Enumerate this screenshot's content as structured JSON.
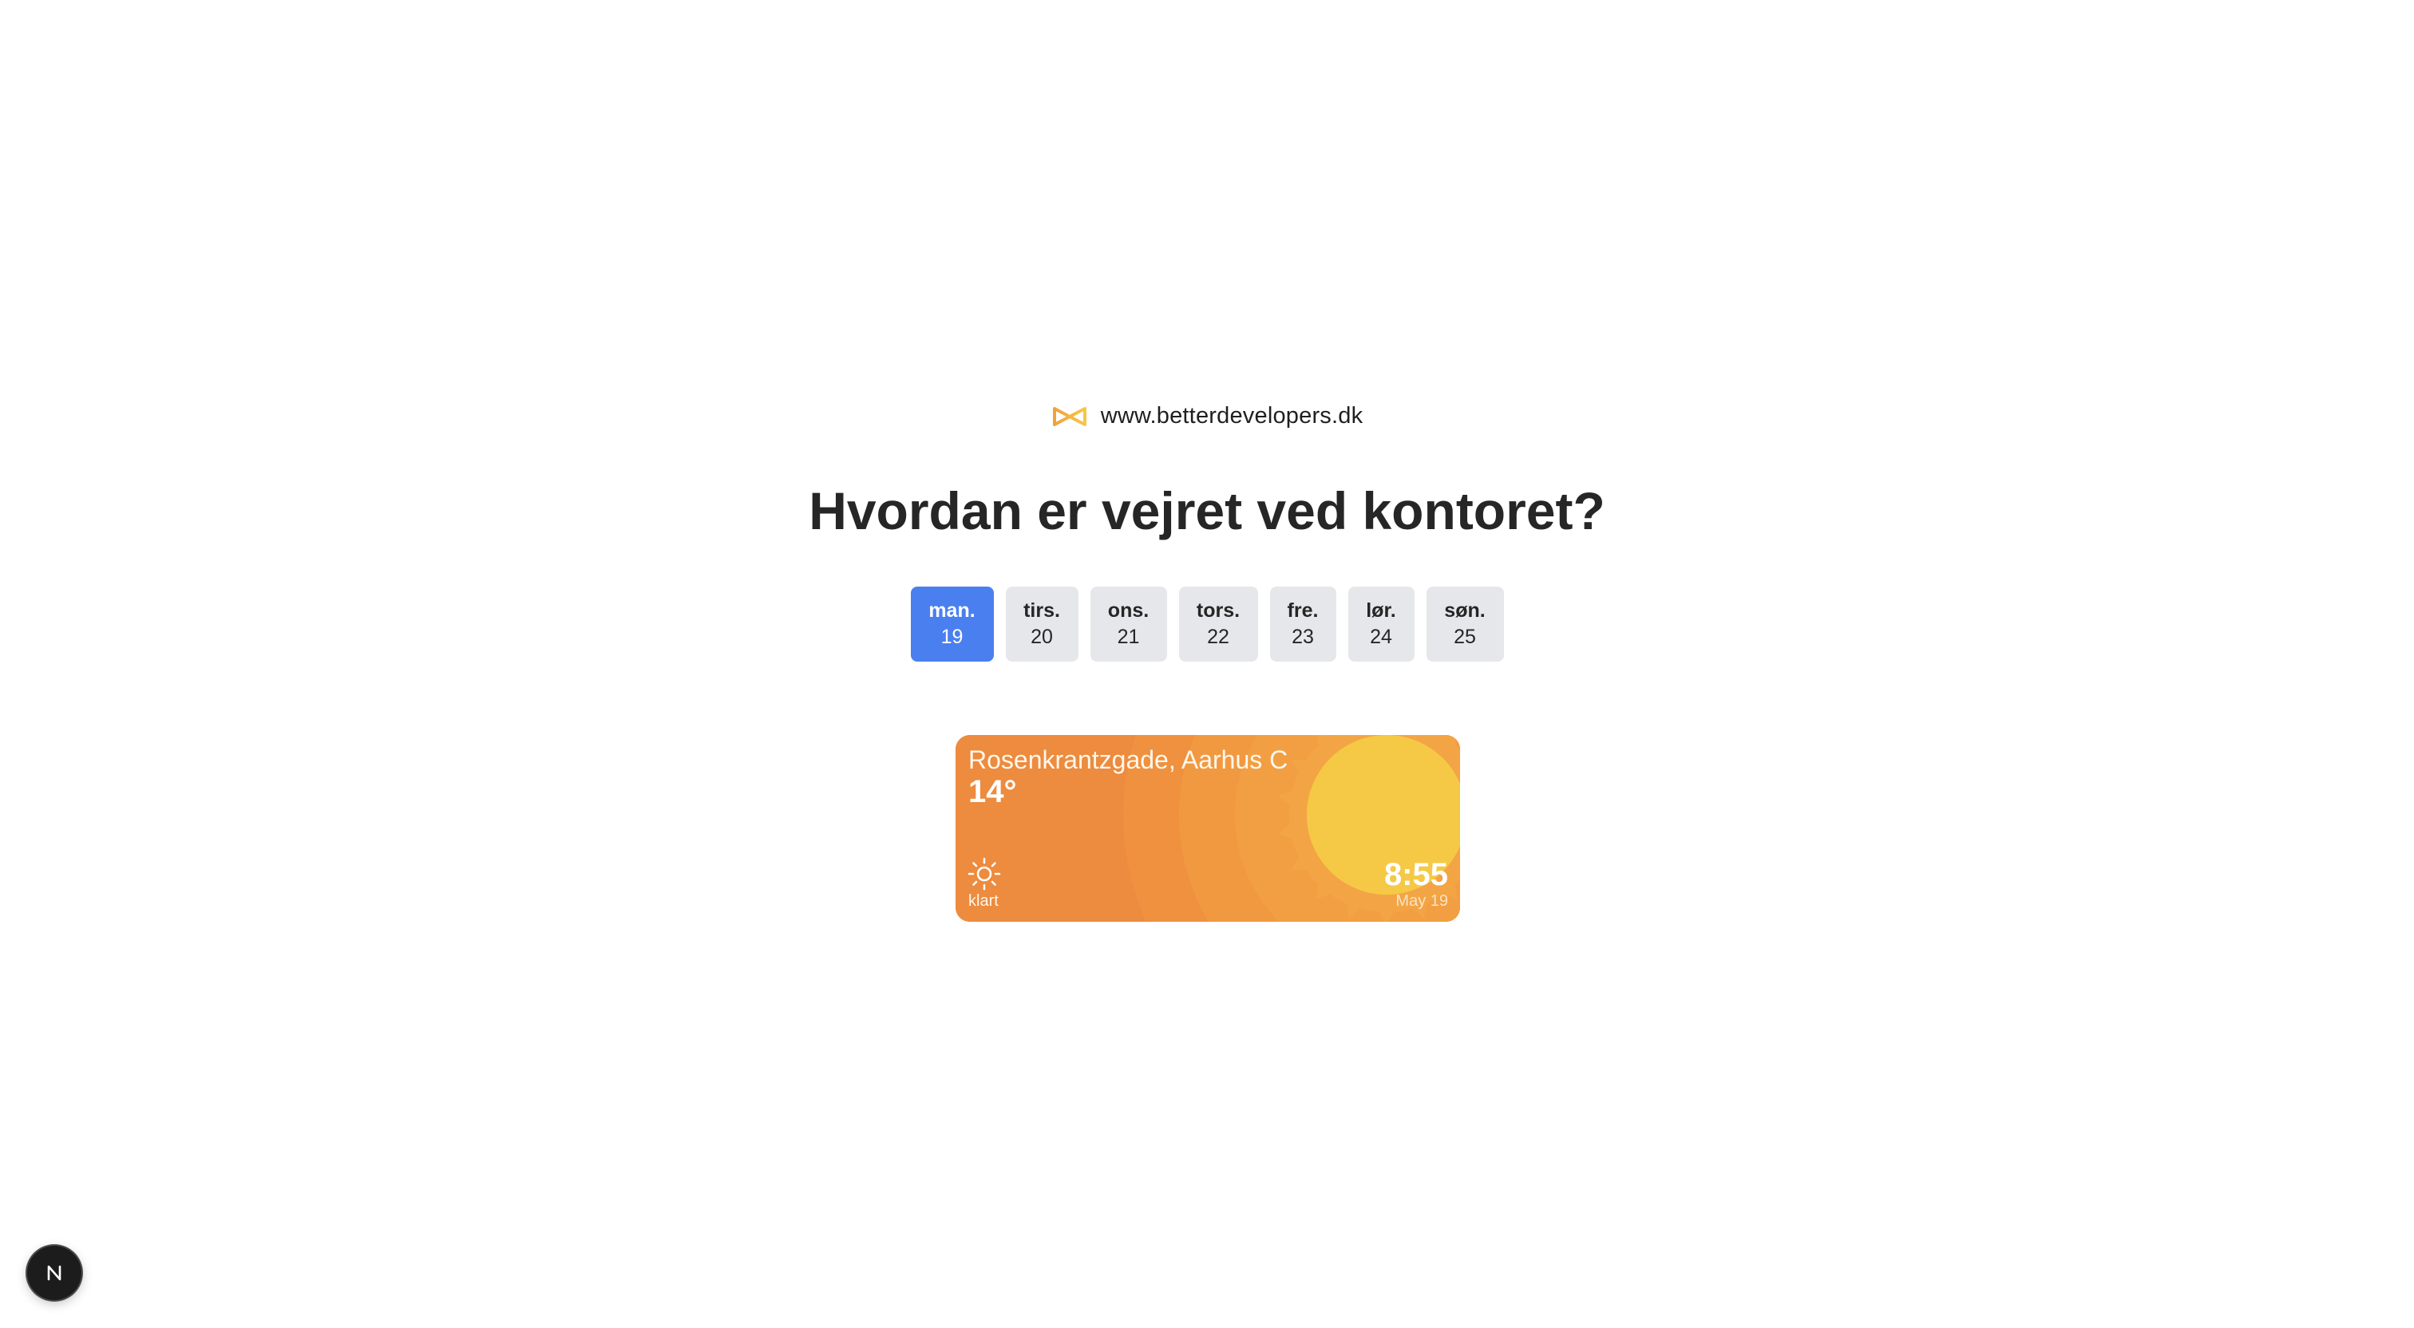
{
  "brand": {
    "url": "www.betterdevelopers.dk",
    "logo_icon": "infinity-logo-icon",
    "logo_color": "#f0a23a"
  },
  "heading": "Hvordan er vejret ved kontoret?",
  "days": [
    {
      "name": "man.",
      "num": "19",
      "active": true
    },
    {
      "name": "tirs.",
      "num": "20",
      "active": false
    },
    {
      "name": "ons.",
      "num": "21",
      "active": false
    },
    {
      "name": "tors.",
      "num": "22",
      "active": false
    },
    {
      "name": "fre.",
      "num": "23",
      "active": false
    },
    {
      "name": "lør.",
      "num": "24",
      "active": false
    },
    {
      "name": "søn.",
      "num": "25",
      "active": false
    }
  ],
  "weather": {
    "location": "Rosenkrantzgade, Aarhus C",
    "temperature": "14°",
    "condition": "klart",
    "condition_icon": "sun-icon",
    "time": "8:55",
    "date": "May 19"
  },
  "colors": {
    "active_day": "#4a7ff0",
    "inactive_day": "#e6e7ea",
    "card_orange": "#ed8b3e",
    "sun_yellow": "#f5c945"
  },
  "badge_icon": "nextjs-icon"
}
